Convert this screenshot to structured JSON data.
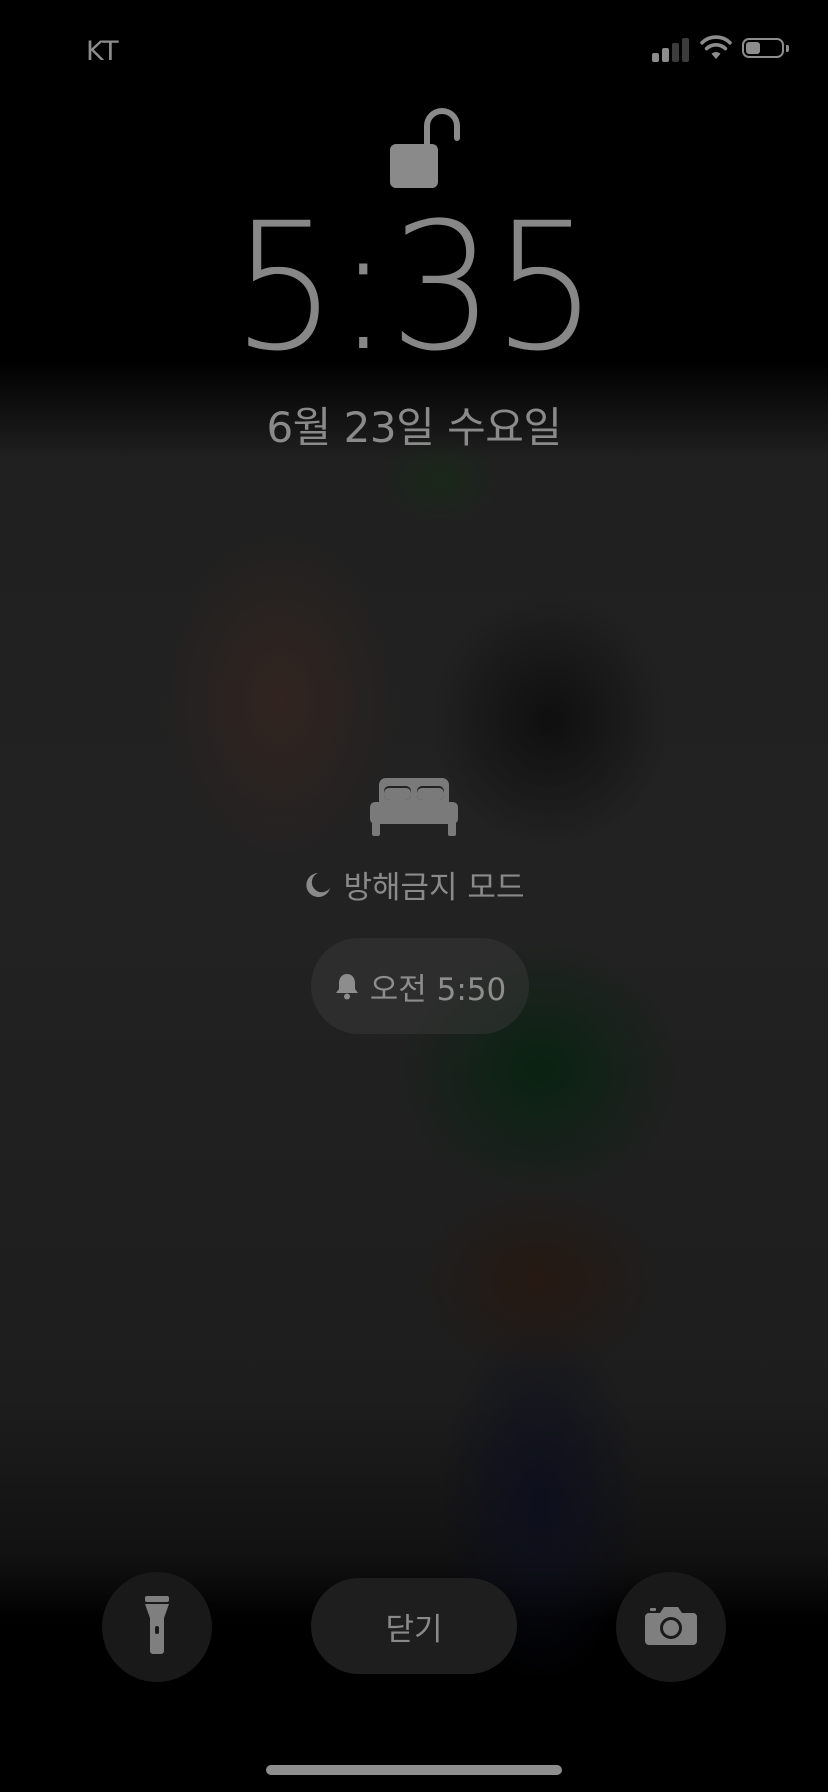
{
  "status_bar": {
    "carrier": "KT",
    "signal_bars": 4,
    "signal_bars_active": 2,
    "wifi_icon": "wifi-icon",
    "battery_level": 0.4,
    "battery_icon": "battery-icon"
  },
  "lock": {
    "state": "unlocked",
    "icon": "unlocked-padlock-icon"
  },
  "clock": {
    "time": "5:35",
    "date": "6월 23일 수요일"
  },
  "focus": {
    "icon": "bed-icon",
    "moon_icon": "moon-icon",
    "label": "방해금지 모드"
  },
  "alarm": {
    "icon": "bell-icon",
    "label": "오전 5:50"
  },
  "bottom_controls": {
    "flashlight_icon": "flashlight-icon",
    "dismiss_label": "닫기",
    "camera_icon": "camera-icon"
  },
  "colors": {
    "foreground": "#8a8a8a",
    "background": "#000000",
    "button_background": "#1e1e1e"
  }
}
